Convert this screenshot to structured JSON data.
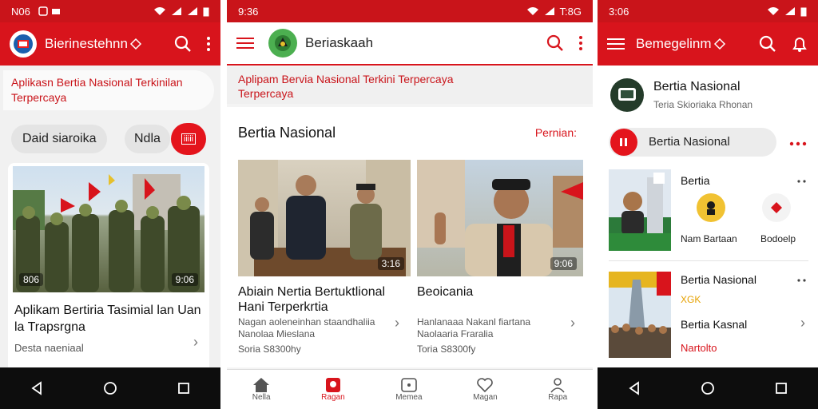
{
  "phone1": {
    "status": {
      "time": "N06"
    },
    "appbar": {
      "title": "Bierinestehnn"
    },
    "banner": {
      "text": "Aplikasn Bertia Nasional Terkinilan Terpercaya"
    },
    "chips": [
      "Daid siaroika",
      "Ndla",
      "iiiii"
    ],
    "card": {
      "duration_left": "806",
      "duration_right": "9:06",
      "title": "Aplikam Bertiria Tasimial lan Uan la Trapsrgna",
      "meta": "Desta naeniaal"
    }
  },
  "phone2": {
    "status": {
      "time": "9:36",
      "right": "T:8G"
    },
    "appbar": {
      "title": "Beriaskaah"
    },
    "banner": {
      "text": "Aplipam Bervia Nasional Terkini Terpercaya Terpercaya"
    },
    "section": {
      "title": "Bertia Nasional",
      "action": "Pernian:"
    },
    "articles": [
      {
        "duration": "3:16",
        "title": "Abiain Nertia Bertuktlional Hani Terperkrtia",
        "desc": "Nagan aoleneinhan staandhaliia Nanolaa Mieslana",
        "meta": "Soria S8300hy"
      },
      {
        "duration": "9:06",
        "title": "Beoicania",
        "desc": "Hanlanaaa Nakanl fiartana Naolaaria Fraralia",
        "meta": "Toria S8300fy"
      }
    ],
    "bottom_nav": [
      "Nella",
      "Ragan",
      "Memea",
      "Magan",
      "Rapa"
    ]
  },
  "phone3": {
    "status": {
      "time": "3:06"
    },
    "appbar": {
      "title": "Bemegelinm"
    },
    "profile": {
      "name": "Bertia Nasional",
      "sub": "Teria Skioriaka Rhonan"
    },
    "pill": {
      "label": "Bertia Nasional"
    },
    "items": [
      {
        "title": "Bertia",
        "cat1": "Nam Bartaan",
        "cat2": "Bodoelp"
      },
      {
        "title": "Bertia Nasional",
        "tag": "XGK",
        "subtitle": "Bertia Kasnal",
        "link": "Nartolto"
      }
    ]
  },
  "colors": {
    "brand": "#d8141c",
    "statusbar": "#c9141a",
    "navbar": "#0d0d0d"
  },
  "icons": [
    "back-icon",
    "home-icon",
    "recents-icon",
    "search-icon",
    "more-icon",
    "menu-icon",
    "wifi-icon",
    "signal-icon",
    "battery-icon"
  ]
}
